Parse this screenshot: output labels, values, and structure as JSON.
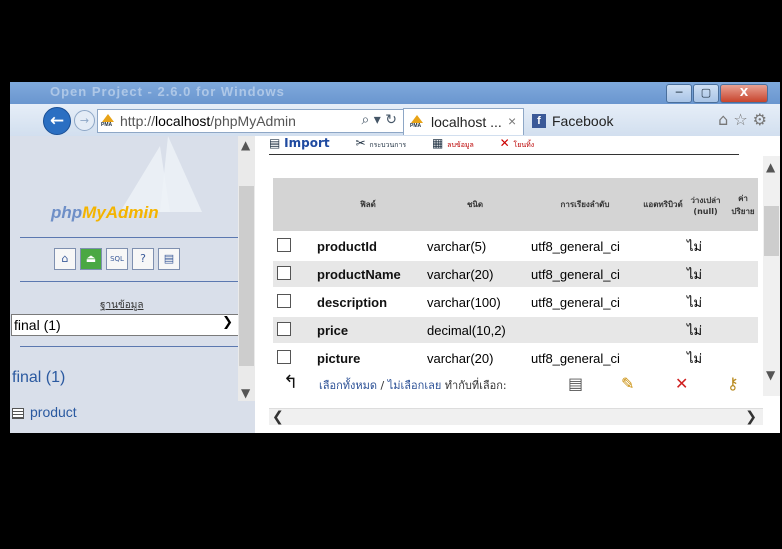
{
  "window": {
    "title": "Open Project - 2.6.0 for Windows",
    "controls": {
      "minimize": "─",
      "maximize": "▢",
      "close": "X"
    }
  },
  "browser": {
    "back_icon": "arrow-left-icon",
    "forward_icon": "arrow-right-icon",
    "url_prefix": "http://",
    "url_host": "localhost",
    "url_path": "/phpMyAdmin",
    "address_icons": "⌕ ▾ ↻",
    "favicon_label": "PMA",
    "tabs": [
      {
        "label": "localhost ...",
        "close": "×",
        "active": true
      },
      {
        "label": "Facebook",
        "active": false
      }
    ],
    "toolbar_icons": [
      "home-icon",
      "star-icon",
      "gear-icon"
    ]
  },
  "sidebar": {
    "logo_prefix": "php",
    "logo_accent": "MyAdmin",
    "icons": [
      "home-icon",
      "exit-icon",
      "sql-icon",
      "help-icon",
      "docs-icon"
    ],
    "icon_glyphs": [
      "⌂",
      "⏏",
      "SQL",
      "?",
      "▤"
    ],
    "db_label": "ฐานข้อมูล",
    "db_select_value": "final (1)",
    "db_title": "final (1)",
    "tables": [
      "product"
    ]
  },
  "main": {
    "tabs": [
      {
        "label": "Import"
      },
      {
        "label": "กระบวนการ"
      },
      {
        "label": "ลบข้อมูล"
      },
      {
        "label": "โยนทิ้ง"
      }
    ],
    "table": {
      "headers": [
        "ฟิลด์",
        "ชนิด",
        "การเรียงลำดับ",
        "แอตทริบิวต์",
        "ว่างเปล่า (null)",
        "ค่าปริยาย"
      ],
      "rows": [
        {
          "field": "productId",
          "type": "varchar(5)",
          "collation": "utf8_general_ci",
          "attributes": "",
          "null": "ไม่"
        },
        {
          "field": "productName",
          "type": "varchar(20)",
          "collation": "utf8_general_ci",
          "attributes": "",
          "null": "ไม่"
        },
        {
          "field": "description",
          "type": "varchar(100)",
          "collation": "utf8_general_ci",
          "attributes": "",
          "null": "ไม่"
        },
        {
          "field": "price",
          "type": "decimal(10,2)",
          "collation": "",
          "attributes": "",
          "null": "ไม่"
        },
        {
          "field": "picture",
          "type": "varchar(20)",
          "collation": "utf8_general_ci",
          "attributes": "",
          "null": "ไม่"
        }
      ]
    },
    "footer": {
      "check_all": "เลือกทั้งหมด",
      "separator": "/",
      "uncheck_all": "ไม่เลือกเลย",
      "with_selected": "ทำกับที่เลือก:"
    }
  },
  "colors": {
    "pma_blue": "#6e8fc7",
    "pma_gold": "#f4b400",
    "titlebar": "#6a96cf"
  }
}
